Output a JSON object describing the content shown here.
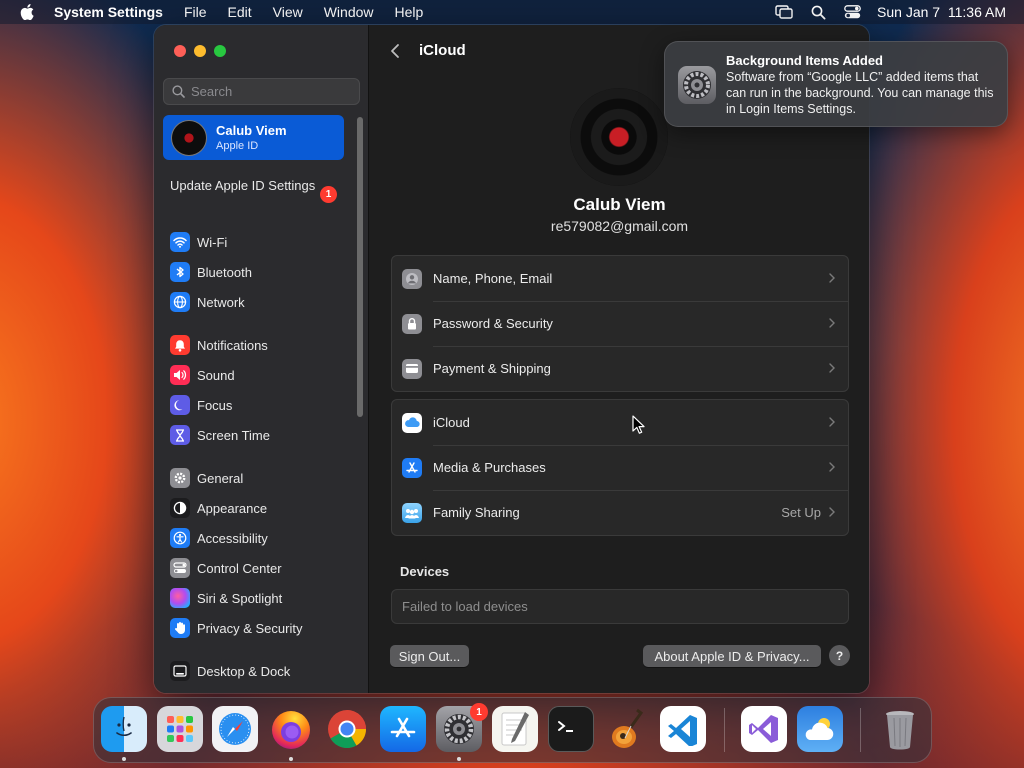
{
  "menubar": {
    "app_name": "System Settings",
    "menus": [
      "File",
      "Edit",
      "View",
      "Window",
      "Help"
    ],
    "datetime": "Sun Jan 7  11:36 AM"
  },
  "sidebar": {
    "search_placeholder": "Search",
    "account": {
      "name": "Calub Viem",
      "subtitle": "Apple ID"
    },
    "update_label": "Update Apple ID Settings",
    "update_badge": "1",
    "items": [
      {
        "label": "Wi-Fi",
        "icon": "wifi-icon",
        "color": "#1f7cf5"
      },
      {
        "label": "Bluetooth",
        "icon": "bluetooth-icon",
        "color": "#1f7cf5"
      },
      {
        "label": "Network",
        "icon": "globe-icon",
        "color": "#1f7cf5"
      },
      {
        "label": "Notifications",
        "icon": "bell-icon",
        "color": "#ff3b30"
      },
      {
        "label": "Sound",
        "icon": "speaker-icon",
        "color": "#ff2d55"
      },
      {
        "label": "Focus",
        "icon": "moon-icon",
        "color": "#5e5ce6"
      },
      {
        "label": "Screen Time",
        "icon": "hourglass-icon",
        "color": "#5e5ce6"
      },
      {
        "label": "General",
        "icon": "gear-icon",
        "color": "#8e8e93"
      },
      {
        "label": "Appearance",
        "icon": "appearance-icon",
        "color": "#1c1c1e"
      },
      {
        "label": "Accessibility",
        "icon": "accessibility-icon",
        "color": "#1f7cf5"
      },
      {
        "label": "Control Center",
        "icon": "control-center-icon",
        "color": "#8e8e93"
      },
      {
        "label": "Siri & Spotlight",
        "icon": "siri-icon",
        "color": "#b14cf0"
      },
      {
        "label": "Privacy & Security",
        "icon": "hand-icon",
        "color": "#1f7cf5"
      },
      {
        "label": "Desktop & Dock",
        "icon": "dock-icon",
        "color": "#1c1c1e"
      }
    ]
  },
  "main": {
    "title": "iCloud",
    "profile_name": "Calub Viem",
    "profile_email": "re579082@gmail.com",
    "group1": [
      {
        "label": "Name, Phone, Email",
        "icon": "person-icon",
        "color": "#8e8e93"
      },
      {
        "label": "Password & Security",
        "icon": "lock-icon",
        "color": "#8e8e93"
      },
      {
        "label": "Payment & Shipping",
        "icon": "card-icon",
        "color": "#8e8e93"
      }
    ],
    "group2": [
      {
        "label": "iCloud",
        "icon": "icloud-icon",
        "color": "#ffffff"
      },
      {
        "label": "Media & Purchases",
        "icon": "app-store-icon",
        "color": "#1f7cf5"
      },
      {
        "label": "Family Sharing",
        "icon": "family-icon",
        "color": "#6fc3f7",
        "detail": "Set Up"
      }
    ],
    "devices_label": "Devices",
    "devices_text": "Failed to load devices",
    "sign_out": "Sign Out...",
    "about": "About Apple ID & Privacy...",
    "help": "?"
  },
  "notification": {
    "title": "Background Items Added",
    "body": "Software from “Google LLC” added items that can run in the background. You can manage this in Login Items Settings."
  },
  "dock": {
    "apps": [
      "Finder",
      "Launchpad",
      "Safari",
      "Firefox",
      "Chrome",
      "App Store",
      "System Settings",
      "TextEdit",
      "Terminal",
      "GarageBand",
      "VS Code",
      "Visual Studio",
      "Weather",
      "Trash"
    ],
    "settings_badge": "1"
  }
}
